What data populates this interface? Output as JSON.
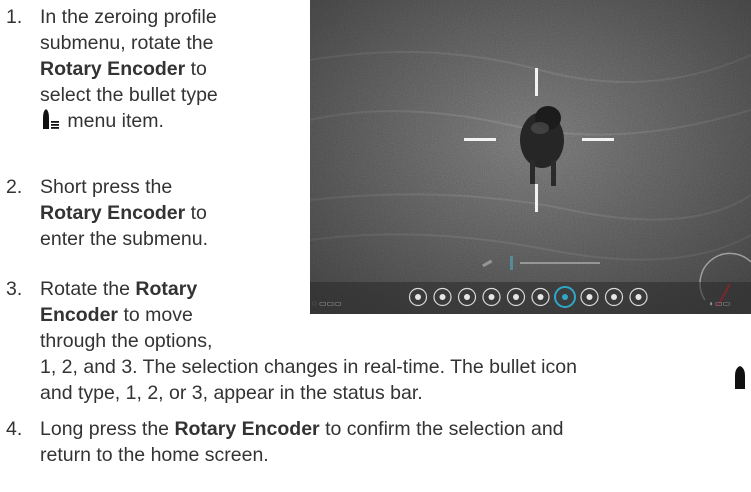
{
  "steps": [
    {
      "num": "1.",
      "lines": [
        "In the zeroing profile",
        "submenu, rotate the",
        "Rotary Encoder",
        "to",
        "select the bullet type",
        "menu item."
      ]
    },
    {
      "num": "2.",
      "lines": [
        "Short press the",
        "Rotary Encoder",
        "to",
        "enter the submenu."
      ]
    },
    {
      "num": "3.",
      "lines": [
        "Rotate the",
        "Rotary",
        "Encoder",
        "to move",
        "through the options,",
        "1, 2, and 3. The selection changes in real-time. The bullet icon",
        "and type, 1, 2, or 3, appear in the status bar."
      ]
    },
    {
      "num": "4.",
      "lines": [
        "Long press the",
        "Rotary Encoder",
        "to confirm the selection and",
        "return to the home screen."
      ]
    }
  ],
  "icons": {
    "bullet_type": "bullet-type-icon",
    "bullet": "bullet-icon"
  },
  "colors": {
    "text": "#333333",
    "scope_bg": "#6e6e6e",
    "reticle": "#f2f2f2",
    "menu_selected": "#2fa7c8"
  }
}
